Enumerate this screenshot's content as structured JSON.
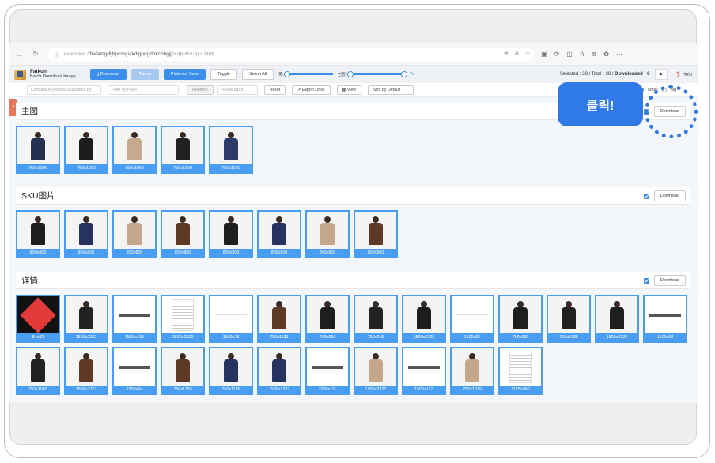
{
  "browser": {
    "url_dim": "extension://",
    "url_main": "hafamgdljbpcmgiakdigodgdpkchhgjj",
    "url_path": "/output/output.html",
    "icons": [
      "read-aloud-icon",
      "text-size-icon",
      "favorite-icon",
      "extensions-icon",
      "refresh-icon",
      "split-screen-icon",
      "favorites-bar-icon",
      "collections-icon",
      "copilot-icon",
      "more-icon"
    ]
  },
  "toolbar": {
    "brand_title": "Fatkun",
    "brand_sub": "Batch Download Image",
    "download": "⤓ Download",
    "pause": "Pause",
    "pinterest": "Pinterest Save",
    "toggle": "Toggle",
    "select_all": "Select All",
    "width_label": "폭:",
    "height_label": "신장:",
    "selected_label": "Selected : 38 / Total : 38 / ",
    "downloaded_label": "Downloaded : 0",
    "caret": "▲",
    "help": "❓ Help"
  },
  "filterbar": {
    "keyword_placeholder": "Contains keywords(Separated by",
    "page_filter": "Filter by Page",
    "rename": "Rename",
    "please_input": "Please input",
    "reset": "Reset",
    "export_links": "⇗ Export Links",
    "view": "▦ View",
    "sort": "Sort by Default",
    "size_small": "Small",
    "size_big": "Big"
  },
  "callout": "클릭!",
  "sections": [
    {
      "title": "主图",
      "download": "Download",
      "items": [
        {
          "size": "750x1000",
          "color": "#263050"
        },
        {
          "size": "750x1000",
          "color": "#1d1d1d"
        },
        {
          "size": "750x1000",
          "color": "#c7a98e"
        },
        {
          "size": "750x1000",
          "color": "#222222"
        },
        {
          "size": "750x1000",
          "color": "#2e3a6a"
        }
      ]
    },
    {
      "title": "SKU图片",
      "download": "Download",
      "items": [
        {
          "size": "800x800",
          "color": "#1e1e1e"
        },
        {
          "size": "800x800",
          "color": "#26335e"
        },
        {
          "size": "800x800",
          "color": "#c4a78a"
        },
        {
          "size": "800x800",
          "color": "#5e3a26"
        },
        {
          "size": "800x800",
          "color": "#1e1e1e"
        },
        {
          "size": "800x800",
          "color": "#26335e"
        },
        {
          "size": "800x800",
          "color": "#c4a78a"
        },
        {
          "size": "800x800",
          "color": "#5e3a26"
        }
      ]
    },
    {
      "title": "详情",
      "download": "Download",
      "items": [
        {
          "size": "84x82",
          "color": "heart"
        },
        {
          "size": "1500x2322",
          "color": "#222222"
        },
        {
          "size": "1500x433",
          "color": "strip"
        },
        {
          "size": "1500x2322",
          "color": "doc"
        },
        {
          "size": "1500x78",
          "color": "blank"
        },
        {
          "size": "750x1133",
          "color": "#5e3a26"
        },
        {
          "size": "750x996",
          "color": "#1e1e1e"
        },
        {
          "size": "750x915",
          "color": "#222222"
        },
        {
          "size": "1500x2322",
          "color": "#1e1e1e"
        },
        {
          "size": "1500x82",
          "color": "blank"
        },
        {
          "size": "750x990",
          "color": "#1e1e1e"
        },
        {
          "size": "750x1085",
          "color": "#222222"
        },
        {
          "size": "1500x2322",
          "color": "#1e1e1e"
        },
        {
          "size": "1500x94",
          "color": "strip"
        },
        {
          "size": "750x1065",
          "color": "#222222"
        },
        {
          "size": "1500x2322",
          "color": "#5e3a26"
        },
        {
          "size": "1500x94",
          "color": "strip"
        },
        {
          "size": "750x1155",
          "color": "#5e3a26"
        },
        {
          "size": "750x1136",
          "color": "#26335e"
        },
        {
          "size": "1500x2322",
          "color": "#26335e"
        },
        {
          "size": "1500x111",
          "color": "strip"
        },
        {
          "size": "1500x2322",
          "color": "#c4a78a"
        },
        {
          "size": "1500x153",
          "color": "strip"
        },
        {
          "size": "750x1079",
          "color": "#c4a78a"
        },
        {
          "size": "1125x960",
          "color": "doc"
        }
      ]
    }
  ]
}
